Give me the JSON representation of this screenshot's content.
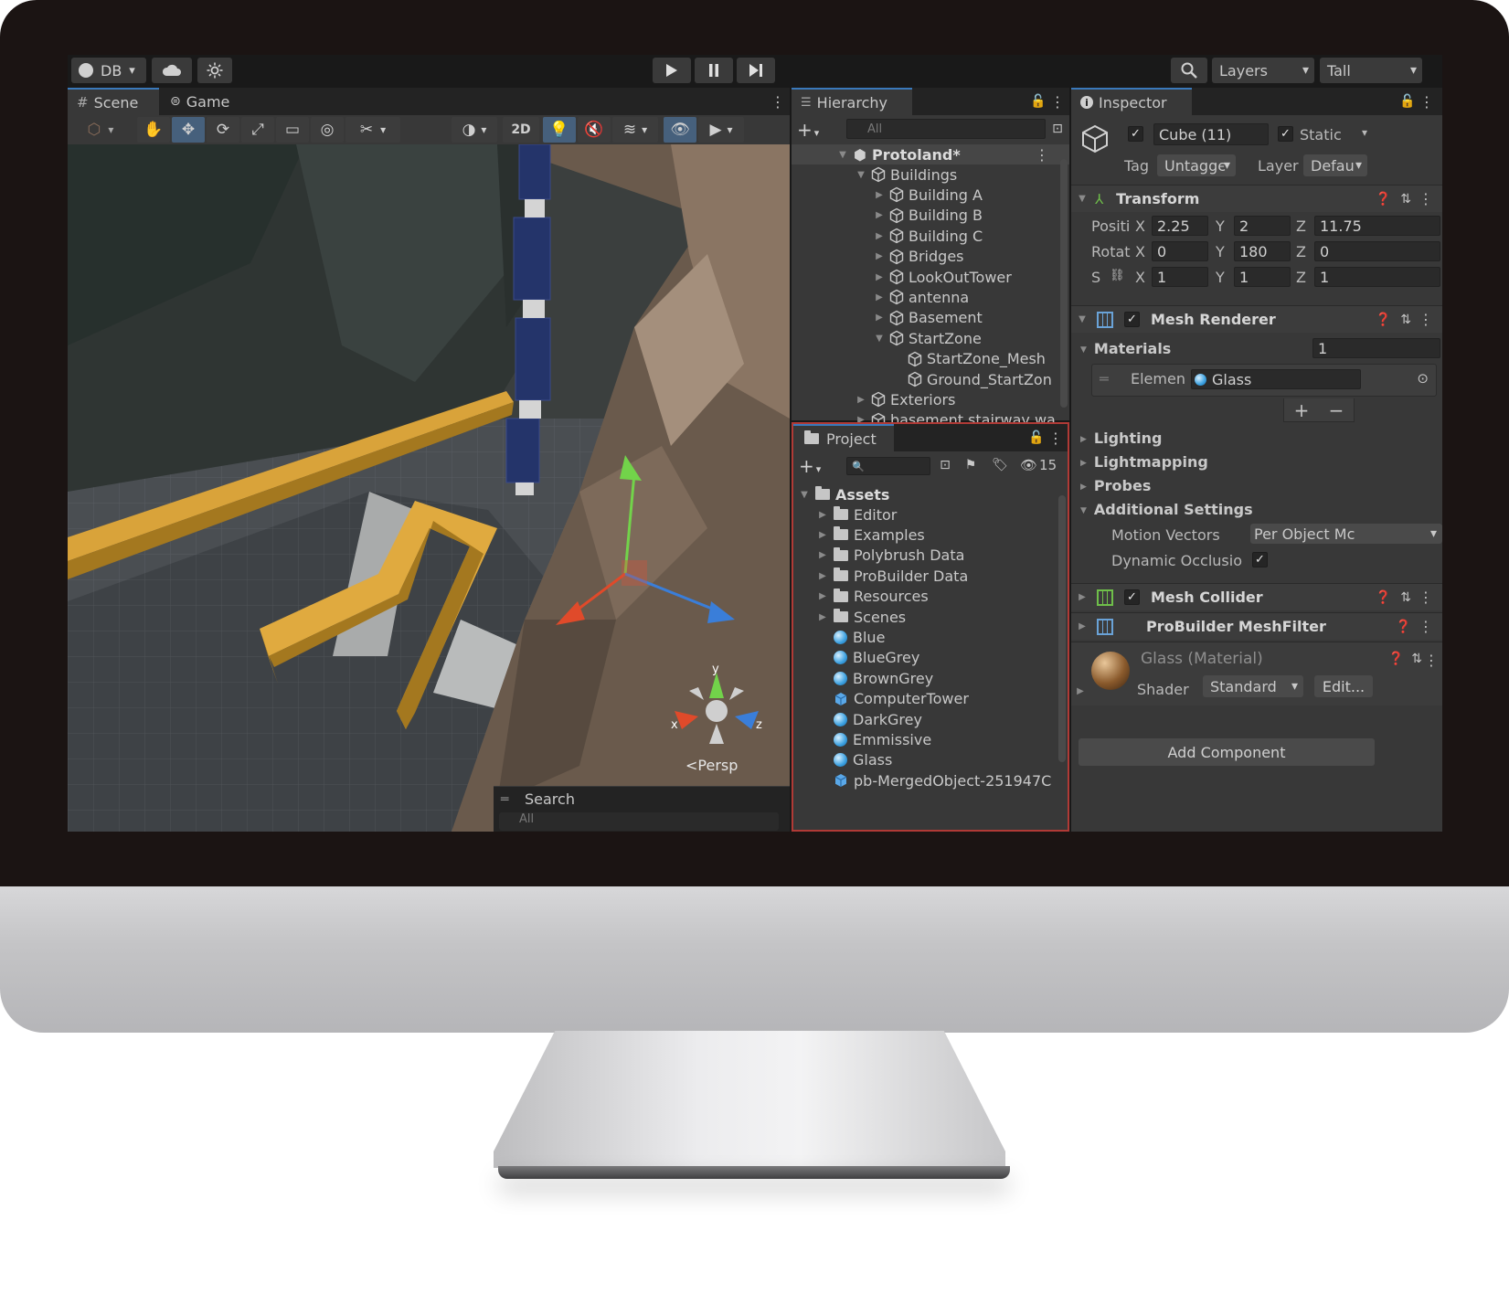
{
  "toolbar": {
    "account": "DB",
    "layers": "Layers",
    "layout": "Tall"
  },
  "scene": {
    "tabs": [
      "Scene",
      "Game"
    ],
    "mode_2d": "2D",
    "persp": "Persp",
    "gizmo_y": "y",
    "gizmo_x": "x",
    "gizmo_z": "z",
    "search_title": "Search",
    "search_placeholder": "All"
  },
  "hierarchy": {
    "title": "Hierarchy",
    "search_placeholder": "All",
    "scene_name": "Protoland*",
    "items": [
      {
        "label": "Buildings",
        "depth": 1,
        "expanded": true
      },
      {
        "label": "Building A",
        "depth": 2
      },
      {
        "label": "Building B",
        "depth": 2
      },
      {
        "label": "Building C",
        "depth": 2
      },
      {
        "label": "Bridges",
        "depth": 2
      },
      {
        "label": "LookOutTower",
        "depth": 2
      },
      {
        "label": "antenna",
        "depth": 2
      },
      {
        "label": "Basement",
        "depth": 2
      },
      {
        "label": "StartZone",
        "depth": 2,
        "expanded": true
      },
      {
        "label": "StartZone_Mesh",
        "depth": 3
      },
      {
        "label": "Ground_StartZon",
        "depth": 3
      },
      {
        "label": "Exteriors",
        "depth": 1
      },
      {
        "label": "basement stairway wa",
        "depth": 1
      }
    ]
  },
  "project": {
    "title": "Project",
    "hidden_count": "15",
    "root": "Assets",
    "folders": [
      "Editor",
      "Examples",
      "Polybrush Data",
      "ProBuilder Data",
      "Resources",
      "Scenes"
    ],
    "assets": [
      {
        "label": "Blue",
        "kind": "material"
      },
      {
        "label": "BlueGrey",
        "kind": "material"
      },
      {
        "label": "BrownGrey",
        "kind": "material"
      },
      {
        "label": "ComputerTower",
        "kind": "prefab"
      },
      {
        "label": "DarkGrey",
        "kind": "material"
      },
      {
        "label": "Emmissive",
        "kind": "material"
      },
      {
        "label": "Glass",
        "kind": "material"
      },
      {
        "label": "pb-MergedObject-251947C",
        "kind": "prefab"
      }
    ]
  },
  "inspector": {
    "title": "Inspector",
    "object_name": "Cube (11)",
    "static_label": "Static",
    "tag_label": "Tag",
    "tag_value": "Untaggє",
    "layer_label": "Layer",
    "layer_value": "Defau",
    "transform": {
      "title": "Transform",
      "rows": [
        {
          "label": "Positi",
          "x": "2.25",
          "y": "2",
          "z": "11.75"
        },
        {
          "label": "Rotat",
          "x": "0",
          "y": "180",
          "z": "0"
        },
        {
          "label": "S",
          "x": "1",
          "y": "1",
          "z": "1"
        }
      ],
      "axis_x": "X",
      "axis_y": "Y",
      "axis_z": "Z"
    },
    "mesh_renderer": {
      "title": "Mesh Renderer",
      "materials_label": "Materials",
      "materials_count": "1",
      "element_label": "Elemen",
      "element_value": "Glass",
      "add": "+",
      "remove": "−",
      "sections": [
        "Lighting",
        "Lightmapping",
        "Probes",
        "Additional Settings"
      ],
      "motion_vectors_label": "Motion Vectors",
      "motion_vectors_value": "Per Object Mc",
      "dynamic_occlusion_label": "Dynamic Occlusio"
    },
    "mesh_collider": {
      "title": "Mesh Collider"
    },
    "probuilder": {
      "title": "ProBuilder MeshFilter"
    },
    "material": {
      "title": "Glass (Material)",
      "shader_label": "Shader",
      "shader_value": "Standard",
      "edit": "Edit..."
    },
    "add_component": "Add Component"
  }
}
